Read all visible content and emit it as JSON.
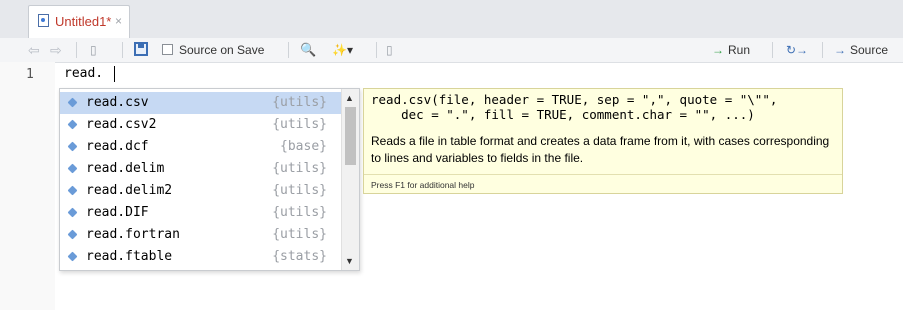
{
  "tab": {
    "title": "Untitled1*",
    "close": "×",
    "icon": "r-script-icon"
  },
  "toolbar": {
    "back": "⇦",
    "forward": "⇨",
    "source_on_save": "Source on Save",
    "search_glyph": "🔍",
    "wand_glyph": "✨▾",
    "page_glyph": "▯",
    "run_arrow": "→",
    "run_label": "Run",
    "rerun_glyph": "↻→",
    "source_arrow": "→",
    "source_label": "Source"
  },
  "editor": {
    "line_number": "1",
    "code": "read."
  },
  "completion": {
    "items": [
      {
        "name": "read.csv",
        "package": "{utils}"
      },
      {
        "name": "read.csv2",
        "package": "{utils}"
      },
      {
        "name": "read.dcf",
        "package": "{base}"
      },
      {
        "name": "read.delim",
        "package": "{utils}"
      },
      {
        "name": "read.delim2",
        "package": "{utils}"
      },
      {
        "name": "read.DIF",
        "package": "{utils}"
      },
      {
        "name": "read.fortran",
        "package": "{utils}"
      },
      {
        "name": "read.ftable",
        "package": "{stats}"
      }
    ],
    "scroll_up": "▲",
    "scroll_down": "▼"
  },
  "help": {
    "signature": "read.csv(file, header = TRUE, sep = \",\", quote = \"\\\"\",\n    dec = \".\", fill = TRUE, comment.char = \"\", ...)",
    "description": "Reads a file in table format and creates a data frame from it, with cases corresponding to lines and variables to fields in the file.",
    "footer": "Press F1 for additional help"
  }
}
